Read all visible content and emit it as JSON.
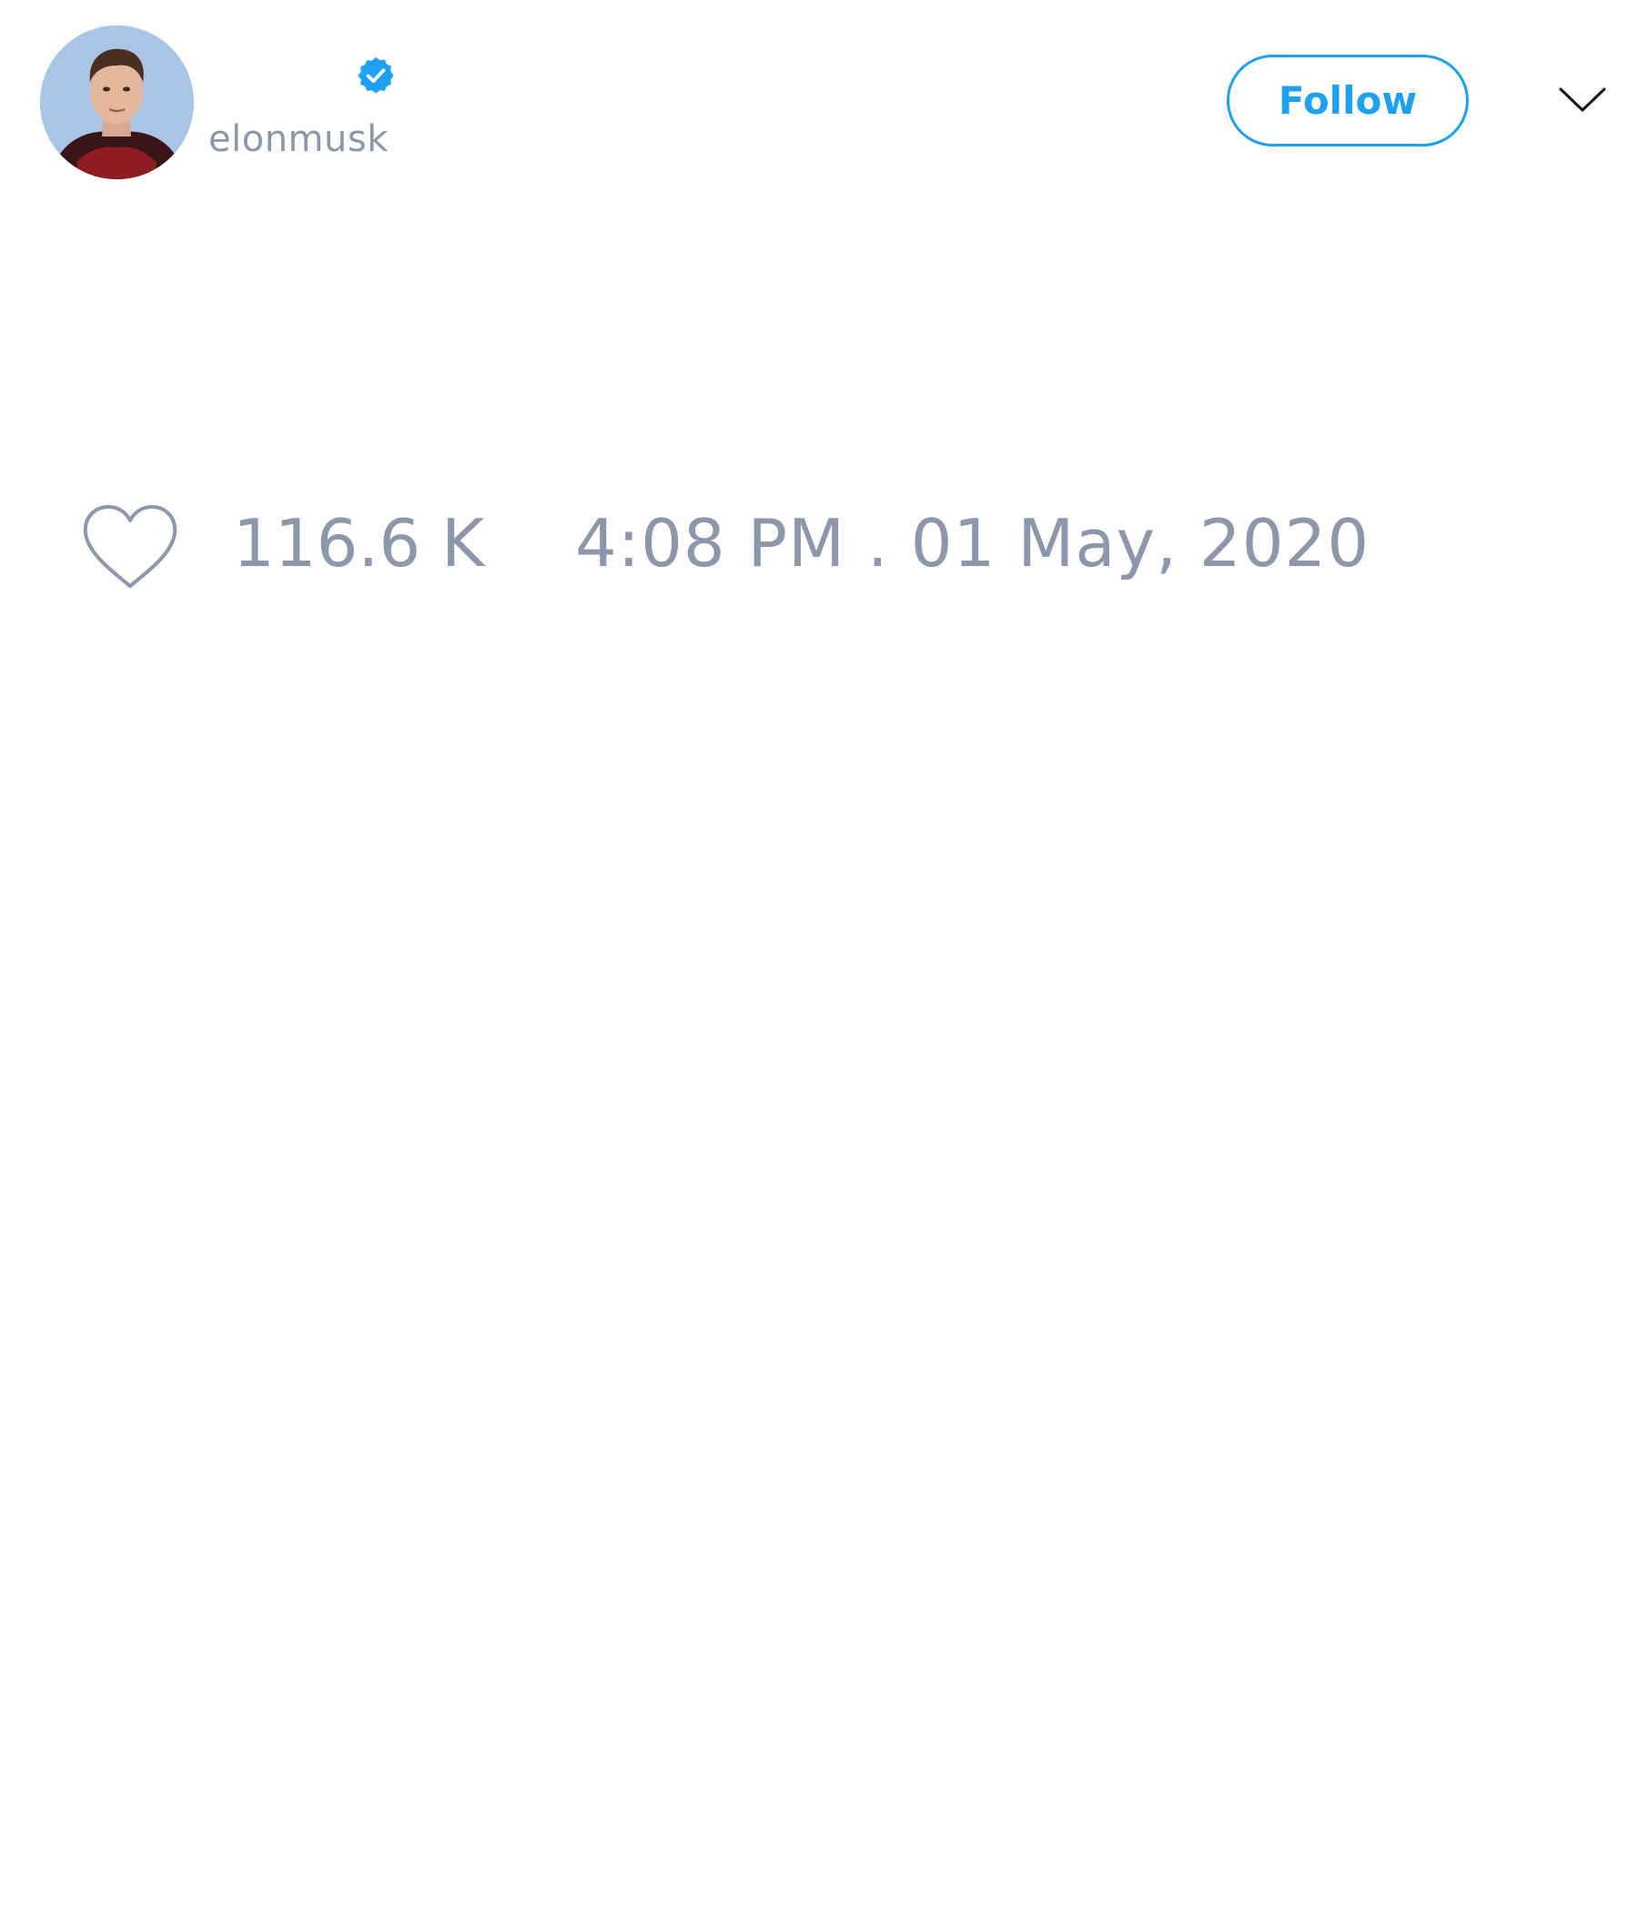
{
  "tweet": {
    "author": {
      "display_name": "",
      "username": "elonmusk",
      "verified": true,
      "avatar_icon": "profile-photo"
    },
    "follow_label": "Follow",
    "menu_icon": "chevron-down-icon",
    "like_icon": "heart-icon",
    "like_count": "116.6 K",
    "timestamp": "4:08 PM . 01 May, 2020"
  },
  "colors": {
    "accent": "#1da1f2",
    "muted_text": "#8b98ab",
    "background": "#ffffff"
  }
}
